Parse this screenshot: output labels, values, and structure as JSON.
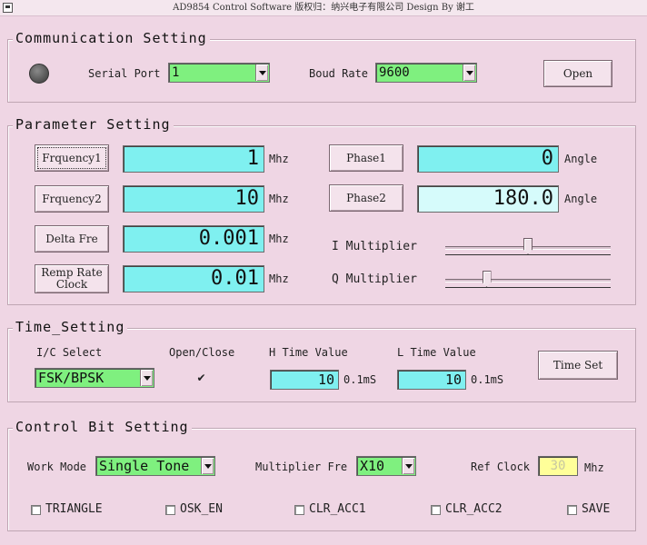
{
  "window": {
    "title": "AD9854 Control Software  版权归：纳兴电子有限公司    Design By 谢工"
  },
  "communication": {
    "legend": "Communication Setting",
    "serial_port_label": "Serial Port",
    "serial_port_value": "1",
    "baud_rate_label": "Boud Rate",
    "baud_rate_value": "9600",
    "open_button": "Open"
  },
  "parameter": {
    "legend": "Parameter Setting",
    "frequency1_button": "Frquency1",
    "frequency1_value": "1",
    "frequency2_button": "Frquency2",
    "frequency2_value": "10",
    "delta_fre_button": "Delta Fre",
    "delta_fre_value": "0.001",
    "ramp_rate_button_line1": "Remp Rate",
    "ramp_rate_button_line2": "Clock",
    "ramp_rate_value": "0.01",
    "unit_mhz": "Mhz",
    "phase1_button": "Phase1",
    "phase1_value": "0",
    "phase2_button": "Phase2",
    "phase2_value": "180.0",
    "unit_angle": "Angle",
    "i_multiplier_label": "I Multiplier",
    "i_multiplier_level": 0.5,
    "q_multiplier_label": "Q Multiplier",
    "q_multiplier_level": 0.25
  },
  "time": {
    "legend": "Time_Setting",
    "ic_select_label": "I/C Select",
    "ic_select_value": "FSK/BPSK",
    "open_close_label": "Open/Close",
    "open_close_checked": true,
    "h_time_label": "H Time Value",
    "h_time_value": "10",
    "l_time_label": "L Time Value",
    "l_time_value": "10",
    "unit_01ms": "0.1mS",
    "time_set_button": "Time Set"
  },
  "control": {
    "legend": "Control Bit Setting",
    "work_mode_label": "Work Mode",
    "work_mode_value": "Single Tone",
    "multiplier_fre_label": "Multiplier Fre",
    "multiplier_fre_value": "X10",
    "ref_clock_label": "Ref Clock",
    "ref_clock_value": "30",
    "ref_clock_unit": "Mhz",
    "checkboxes": [
      {
        "label": "TRIANGLE",
        "checked": false
      },
      {
        "label": "OSK_EN",
        "checked": false
      },
      {
        "label": "CLR_ACC1",
        "checked": false
      },
      {
        "label": "CLR_ACC2",
        "checked": false
      },
      {
        "label": "SAVE",
        "checked": false
      }
    ]
  },
  "colors": {
    "background": "#efd6e4",
    "combo_green": "#7ff07f",
    "numeric_cyan": "#7ff0f0",
    "numeric_light_cyan": "#d6fbfb",
    "ref_yellow": "#ffff99"
  }
}
